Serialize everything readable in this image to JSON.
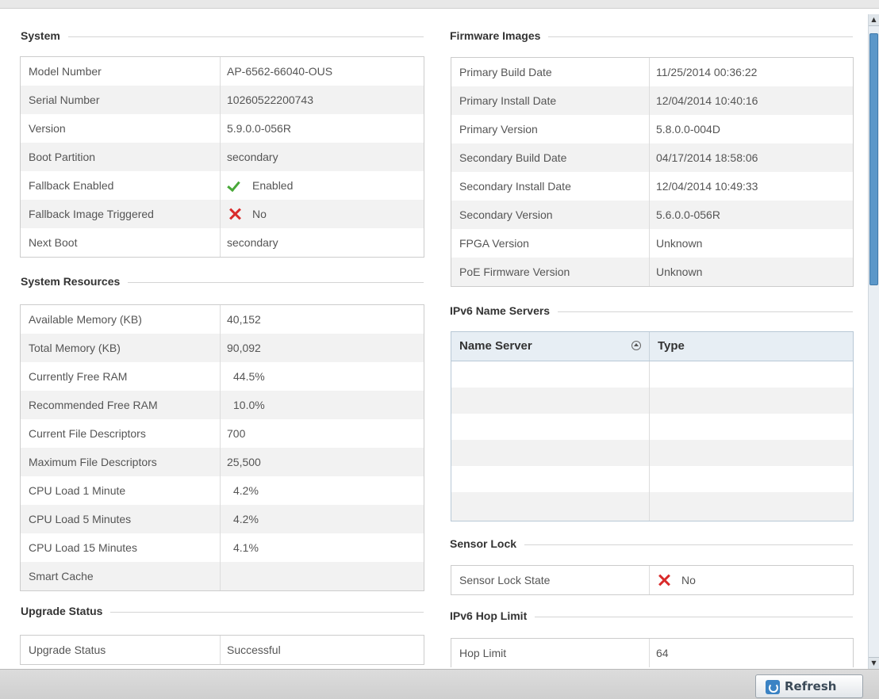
{
  "system": {
    "title": "System",
    "rows": [
      {
        "label": "Model Number",
        "value": "AP-6562-66040-OUS"
      },
      {
        "label": "Serial Number",
        "value": "10260522200743"
      },
      {
        "label": "Version",
        "value": "5.9.0.0-056R"
      },
      {
        "label": "Boot Partition",
        "value": "secondary"
      },
      {
        "label": "Fallback Enabled",
        "value": "Enabled",
        "icon": "check-icon"
      },
      {
        "label": "Fallback Image Triggered",
        "value": "No",
        "icon": "x-icon"
      },
      {
        "label": "Next Boot",
        "value": "secondary"
      }
    ]
  },
  "system_resources": {
    "title": "System Resources",
    "rows": [
      {
        "label": "Available Memory (KB)",
        "value": "40,152"
      },
      {
        "label": "Total Memory (KB)",
        "value": "90,092"
      },
      {
        "label": "Currently Free RAM",
        "value": "44.5%"
      },
      {
        "label": "Recommended Free RAM",
        "value": "10.0%"
      },
      {
        "label": "Current File Descriptors",
        "value": "700"
      },
      {
        "label": "Maximum File Descriptors",
        "value": "25,500"
      },
      {
        "label": "CPU Load 1 Minute",
        "value": "4.2%"
      },
      {
        "label": "CPU Load 5 Minutes",
        "value": "4.2%"
      },
      {
        "label": "CPU Load 15 Minutes",
        "value": "4.1%"
      },
      {
        "label": "Smart Cache",
        "value": ""
      }
    ]
  },
  "upgrade_status": {
    "title": "Upgrade Status",
    "rows": [
      {
        "label": "Upgrade Status",
        "value": "Successful"
      }
    ]
  },
  "firmware_images": {
    "title": "Firmware Images",
    "rows": [
      {
        "label": "Primary Build Date",
        "value": "11/25/2014 00:36:22"
      },
      {
        "label": "Primary Install Date",
        "value": "12/04/2014 10:40:16"
      },
      {
        "label": "Primary Version",
        "value": "5.8.0.0-004D"
      },
      {
        "label": "Secondary Build Date",
        "value": "04/17/2014 18:58:06"
      },
      {
        "label": "Secondary Install Date",
        "value": "12/04/2014 10:49:33"
      },
      {
        "label": "Secondary Version",
        "value": "5.6.0.0-056R"
      },
      {
        "label": "FPGA Version",
        "value": "Unknown"
      },
      {
        "label": "PoE Firmware Version",
        "value": "Unknown"
      }
    ]
  },
  "ipv6_name_servers": {
    "title": "IPv6 Name Servers",
    "columns": [
      "Name Server",
      "Type"
    ]
  },
  "sensor_lock": {
    "title": "Sensor Lock",
    "rows": [
      {
        "label": "Sensor Lock State",
        "value": "No",
        "icon": "x-icon"
      }
    ]
  },
  "ipv6_hop_limit": {
    "title": "IPv6 Hop Limit",
    "rows": [
      {
        "label": "Hop Limit",
        "value": "64"
      }
    ]
  },
  "toolbar": {
    "refresh_label": "Refresh"
  },
  "colors": {
    "accent": "#3b83c4",
    "ok": "#48a838",
    "error": "#d92b2b"
  }
}
